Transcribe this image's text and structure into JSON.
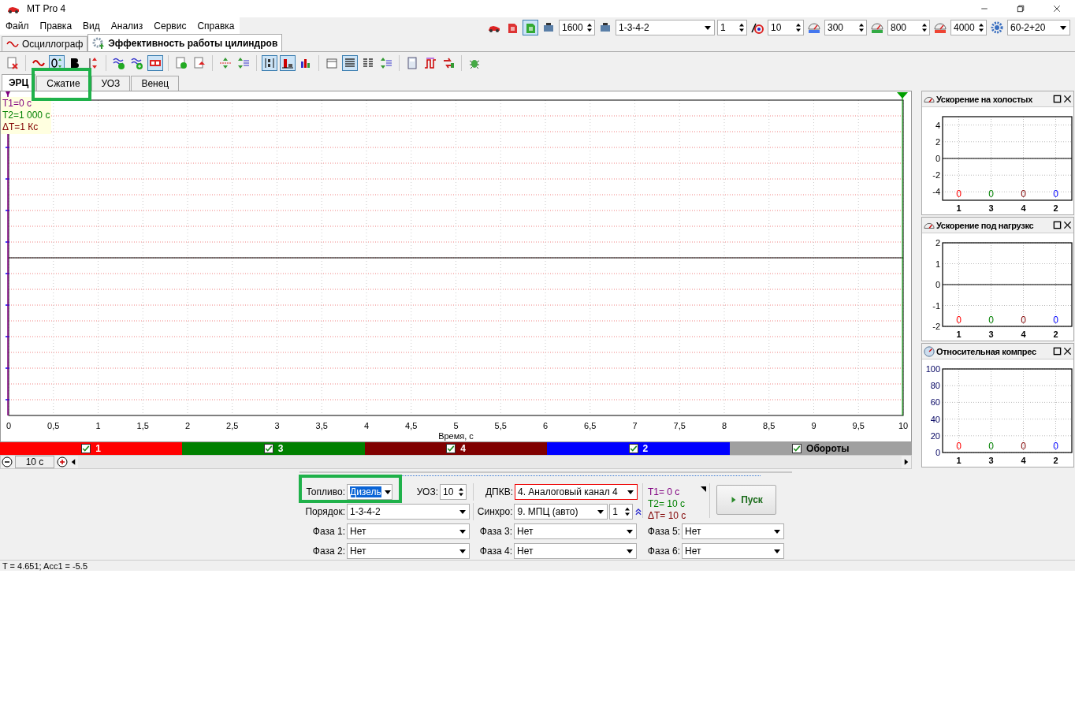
{
  "window": {
    "title": "MT Pro 4"
  },
  "menu": [
    "Файл",
    "Правка",
    "Вид",
    "Анализ",
    "Сервис",
    "Справка"
  ],
  "top_toolbar": [
    {
      "kind": "car"
    },
    {
      "kind": "petrol",
      "pressed": false
    },
    {
      "kind": "diesel",
      "pressed": true
    },
    {
      "kind": "engine"
    },
    {
      "kind": "spin",
      "value": "1600"
    },
    {
      "kind": "engine"
    },
    {
      "kind": "select",
      "value": "1-3-4-2"
    },
    {
      "kind": "spin",
      "value": "1"
    },
    {
      "kind": "angle"
    },
    {
      "kind": "spin",
      "value": "10"
    },
    {
      "kind": "gauge",
      "color": "#4477ee"
    },
    {
      "kind": "spin",
      "value": "300"
    },
    {
      "kind": "gauge",
      "color": "#33aa44"
    },
    {
      "kind": "spin",
      "value": "800"
    },
    {
      "kind": "gauge",
      "color": "#ee4433"
    },
    {
      "kind": "spin",
      "value": "4000"
    },
    {
      "kind": "gear"
    },
    {
      "kind": "select",
      "value": "60-2+20"
    }
  ],
  "main_tabs": [
    {
      "label": "Осциллограф",
      "selected": false
    },
    {
      "label": "Эффективность работы цилиндров",
      "selected": true
    }
  ],
  "toolbar": [
    {
      "kind": "delete",
      "pressed": false
    },
    {
      "kind": "sep"
    },
    {
      "kind": "wave",
      "pressed": false
    },
    {
      "kind": "zero",
      "pressed": true
    },
    {
      "kind": "bold",
      "pressed": false
    },
    {
      "kind": "updown",
      "pressed": false
    },
    {
      "kind": "sep"
    },
    {
      "kind": "wavesok",
      "pressed": false
    },
    {
      "kind": "wavesadd",
      "pressed": false
    },
    {
      "kind": "numbers",
      "pressed": true
    },
    {
      "kind": "sep"
    },
    {
      "kind": "docok",
      "pressed": false
    },
    {
      "kind": "docup",
      "pressed": false
    },
    {
      "kind": "sep"
    },
    {
      "kind": "arrows",
      "pressed": false
    },
    {
      "kind": "scale",
      "pressed": false
    },
    {
      "kind": "sep"
    },
    {
      "kind": "sort",
      "pressed": true
    },
    {
      "kind": "barsred",
      "pressed": true
    },
    {
      "kind": "bars",
      "pressed": false
    },
    {
      "kind": "sep"
    },
    {
      "kind": "window",
      "pressed": false
    },
    {
      "kind": "lines",
      "pressed": true
    },
    {
      "kind": "columns",
      "pressed": false
    },
    {
      "kind": "scale",
      "pressed": false
    },
    {
      "kind": "sep"
    },
    {
      "kind": "calc",
      "pressed": false
    },
    {
      "kind": "pulse",
      "pressed": false
    },
    {
      "kind": "swap",
      "pressed": false
    },
    {
      "kind": "sep"
    },
    {
      "kind": "bug",
      "pressed": false
    }
  ],
  "sub_tabs": [
    {
      "label": "ЭРЦ",
      "selected": true
    },
    {
      "label": "Сжатие",
      "selected": false
    },
    {
      "label": "УОЗ",
      "selected": false
    },
    {
      "label": "Венец",
      "selected": false
    }
  ],
  "cursor_info": [
    {
      "text": "T1=0 c",
      "color": "#800080"
    },
    {
      "text": "T2=1 000 c",
      "color": "#008000"
    },
    {
      "text": "ΔT=1 Кс",
      "color": "#800000"
    }
  ],
  "main_chart": {
    "x_axis_title": "Время, с",
    "x_axis_labels": [
      "0",
      "0,5",
      "1",
      "1,5",
      "2",
      "2,5",
      "3",
      "3,5",
      "4",
      "4,5",
      "5",
      "5,5",
      "6",
      "6,5",
      "7",
      "7,5",
      "8",
      "8,5",
      "9",
      "9,5",
      "10"
    ]
  },
  "channels": [
    {
      "label": "1",
      "color": "#ff0000",
      "checked": true
    },
    {
      "label": "3",
      "color": "#008000",
      "checked": true
    },
    {
      "label": "4",
      "color": "#800000",
      "checked": true
    },
    {
      "label": "2",
      "color": "#0000ff",
      "checked": true
    },
    {
      "label": "Обороты",
      "color": "#a0a0a0",
      "checked": true
    }
  ],
  "time_scale": "10 с",
  "panels": [
    {
      "title": "Ускорение на холостых",
      "chart_data": {
        "type": "bar",
        "categories": [
          "1",
          "3",
          "4",
          "2"
        ],
        "values": [
          0,
          0,
          0,
          0
        ],
        "ylim": [
          -5,
          5
        ],
        "yticks": [
          -4,
          -2,
          0,
          2,
          4
        ],
        "grid": true,
        "data_labels": true
      }
    },
    {
      "title": "Ускорение под нагрузкс",
      "chart_data": {
        "type": "bar",
        "categories": [
          "1",
          "3",
          "4",
          "2"
        ],
        "values": [
          0,
          0,
          0,
          0
        ],
        "ylim": [
          -2,
          2
        ],
        "yticks": [
          -2,
          -1,
          0,
          1,
          2
        ],
        "grid": true,
        "data_labels": true
      }
    },
    {
      "title": "Относительная компрес",
      "chart_data": {
        "type": "bar",
        "categories": [
          "1",
          "3",
          "4",
          "2"
        ],
        "values": [
          0,
          0,
          0,
          0
        ],
        "ylim": [
          0,
          100
        ],
        "yticks": [
          0,
          20,
          40,
          60,
          80,
          100
        ],
        "grid": true,
        "data_labels": true
      }
    }
  ],
  "settings": {
    "fuel": {
      "label": "Топливо:",
      "value": "Дизель"
    },
    "uoz": {
      "label": "УОЗ:",
      "value": "10"
    },
    "dpkv": {
      "label": "ДПКВ:",
      "value": "4. Аналоговый канал 4",
      "invalid": true
    },
    "order": {
      "label": "Порядок:",
      "value": "1-3-4-2"
    },
    "sync": {
      "label": "Синхро:",
      "value": "9. МПЦ (авто)"
    },
    "sync_number": "1",
    "phases": [
      {
        "label": "Фаза 1:",
        "value": "Нет"
      },
      {
        "label": "Фаза 2:",
        "value": "Нет"
      },
      {
        "label": "Фаза 3:",
        "value": "Нет"
      },
      {
        "label": "Фаза 4:",
        "value": "Нет"
      },
      {
        "label": "Фаза 5:",
        "value": "Нет"
      },
      {
        "label": "Фаза 6:",
        "value": "Нет"
      }
    ]
  },
  "markers": [
    {
      "text": "T1= 0 c",
      "color": "#800080"
    },
    {
      "text": "T2= 10 c",
      "color": "#008000"
    },
    {
      "text": "ΔT= 10 c",
      "color": "#800000"
    }
  ],
  "start_button": "Пуск",
  "status_bar": "T = 4.651; Acc1 = -5.5"
}
